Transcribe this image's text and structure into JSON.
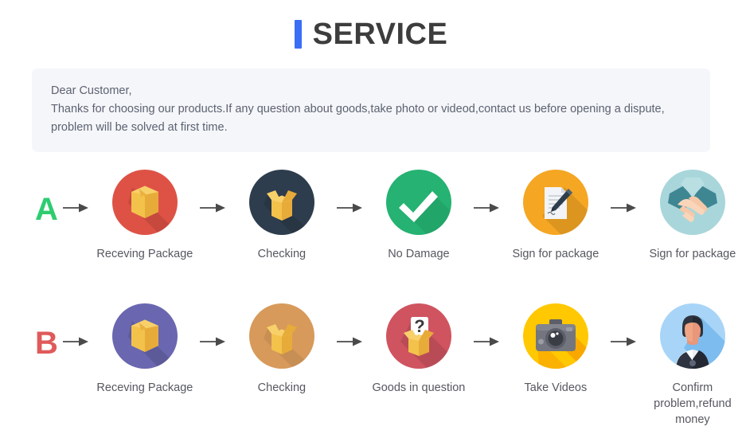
{
  "header": {
    "title": "SERVICE",
    "accent_color": "#3b6ef6"
  },
  "notice": {
    "line1": "Dear Customer,",
    "line2": "Thanks for choosing our products.If any question about goods,take photo or videod,contact us before opening a dispute,",
    "line3": "problem will be solved at first time.",
    "background_color": "#f4f6fa"
  },
  "flows": [
    {
      "badge": "A",
      "badge_color": "#2ecc71",
      "steps": [
        {
          "label": "Receving Package",
          "icon": "closed-box-icon",
          "circle_color": "#de5246"
        },
        {
          "label": "Checking",
          "icon": "open-box-icon",
          "circle_color": "#2e3d4d"
        },
        {
          "label": "No Damage",
          "icon": "check-mark-icon",
          "circle_color": "#25b272"
        },
        {
          "label": "Sign for package",
          "icon": "document-pen-icon",
          "circle_color": "#f5a623"
        },
        {
          "label": "Sign for package",
          "icon": "handshake-icon",
          "circle_color": "#a8d6db"
        }
      ]
    },
    {
      "badge": "B",
      "badge_color": "#e05a5a",
      "steps": [
        {
          "label": "Receving Package",
          "icon": "closed-box-icon",
          "circle_color": "#6a67b0"
        },
        {
          "label": "Checking",
          "icon": "open-box-icon",
          "circle_color": "#d79a5b"
        },
        {
          "label": "Goods in question",
          "icon": "question-box-icon",
          "circle_color": "#cf5460"
        },
        {
          "label": "Take Videos",
          "icon": "camera-icon",
          "circle_color": "#ffc800"
        },
        {
          "label": "Confirm  problem,refund\nmoney",
          "icon": "support-agent-icon",
          "circle_color": "#8ec7f5"
        }
      ]
    }
  ],
  "arrow": {
    "name": "right-arrow-icon",
    "color": "#4a4a4a"
  }
}
